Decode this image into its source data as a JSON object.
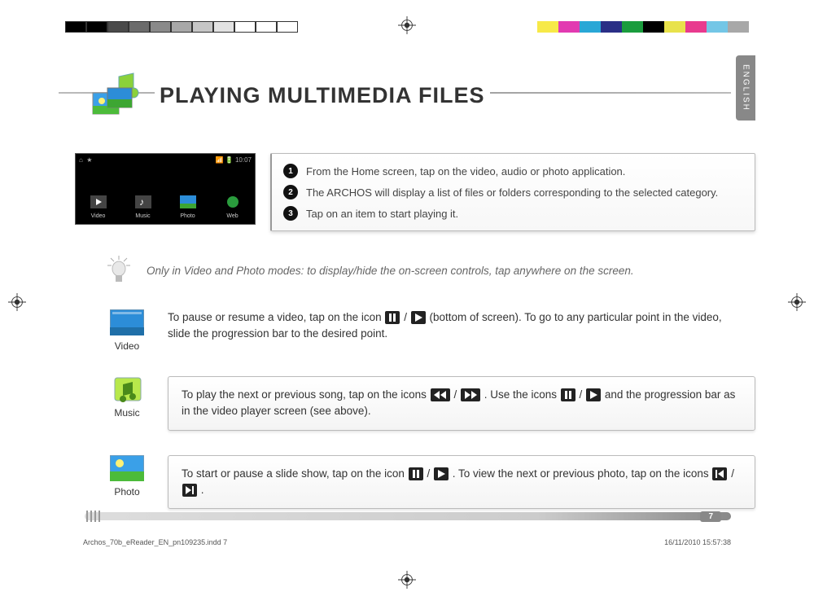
{
  "meta": {
    "language_tab": "ENGLISH",
    "page_number": "7"
  },
  "title": "PLAYING MULTIMEDIA FILES",
  "home_screenshot": {
    "time": "10:07",
    "apps": [
      "Video",
      "Music",
      "Photo",
      "Web"
    ]
  },
  "steps": [
    "From the Home screen, tap on the video, audio or photo application.",
    "The ARCHOS will display a list of files or folders corresponding to the selected category.",
    "Tap on an item to start playing it."
  ],
  "tip": "Only in Video and Photo modes: to display/hide the on-screen controls, tap anywhere on the screen.",
  "sections": {
    "video": {
      "label": "Video",
      "text_a": "To pause or resume a video, tap on the icon ",
      "text_b": " / ",
      "text_c": " (bottom of screen). To go to any particular point in the video, slide the progression bar to the desired point."
    },
    "music": {
      "label": "Music",
      "text_a": "To play the next or previous song, tap on the icons ",
      "text_b": " / ",
      "text_c": ". Use the icons ",
      "text_d": " / ",
      "text_e": " and the progression bar as in the video player screen (see above)."
    },
    "photo": {
      "label": "Photo",
      "text_a": "To start or pause a slide show, tap on the icon ",
      "text_b": " / ",
      "text_c": ". To view the next or previous photo, tap on the icons ",
      "text_d": " / ",
      "text_e": "."
    }
  },
  "footer": {
    "file": "Archos_70b_eReader_EN_pn109235.indd   7",
    "timestamp": "16/11/2010   15:57:38"
  },
  "colorbar_left": [
    "#000000",
    "#000000",
    "#4a4a4a",
    "#6b6b6b",
    "#8a8a8a",
    "#a8a8a8",
    "#c6c6c6",
    "#e2e2e2",
    "#ffffff",
    "#ffffff",
    "#ffffff"
  ],
  "colorbar_right": [
    "#f7e948",
    "#e23ab1",
    "#29a7d6",
    "#2a2f86",
    "#1a9c3d",
    "#000000",
    "#e8e24b",
    "#e83a8e",
    "#73c6e6",
    "#a8a8a8"
  ]
}
